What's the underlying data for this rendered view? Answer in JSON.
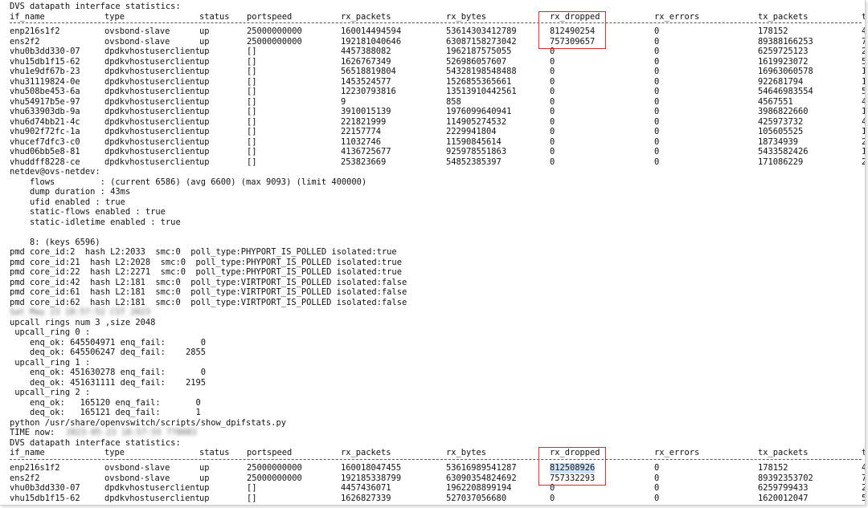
{
  "block1": {
    "title": "DVS datapath interface statistics:",
    "headers": [
      "if_name",
      "type",
      "status",
      "portspeed",
      "rx_packets",
      "rx_bytes",
      "rx_dropped",
      "rx_errors",
      "tx_packets",
      "t"
    ],
    "rows": [
      [
        "enp216s1f2",
        "ovsbond-slave",
        "up",
        "25000000000",
        "160014494594",
        "53614303412789",
        "812490254",
        "0",
        "178152",
        "4"
      ],
      [
        "ens2f2",
        "ovsbond-slave",
        "up",
        "25000000000",
        "192181040646",
        "63087158273042",
        "757309657",
        "0",
        "89388166253",
        "7"
      ],
      [
        "vhu0b3dd330-07",
        "dpdkvhostuserclient",
        "up",
        "[]",
        "4457388082",
        "1962187575055",
        "0",
        "0",
        "6259725123",
        "2"
      ],
      [
        "vhu15db1f15-62",
        "dpdkvhostuserclient",
        "up",
        "[]",
        "1626767349",
        "526986057607",
        "0",
        "0",
        "1619923072",
        "5"
      ],
      [
        "vhu1e9df67b-23",
        "dpdkvhostuserclient",
        "up",
        "[]",
        "56518819804",
        "54328198548488",
        "0",
        "0",
        "16963060578",
        "1"
      ],
      [
        "vhu31119824-0e",
        "dpdkvhostuserclient",
        "up",
        "[]",
        "1453524577",
        "1526855365661",
        "0",
        "0",
        "922681794",
        "1"
      ],
      [
        "vhu508be453-6a",
        "dpdkvhostuserclient",
        "up",
        "[]",
        "12230793816",
        "13513910442561",
        "0",
        "0",
        "54646983554",
        "5"
      ],
      [
        "vhu54917b5e-97",
        "dpdkvhostuserclient",
        "up",
        "[]",
        "9",
        "858",
        "0",
        "0",
        "4567551",
        "4"
      ],
      [
        "vhu633903db-9a",
        "dpdkvhostuserclient",
        "up",
        "[]",
        "3910015139",
        "1976099640941",
        "0",
        "0",
        "3986822660",
        "1"
      ],
      [
        "vhu6d74bb21-4c",
        "dpdkvhostuserclient",
        "up",
        "[]",
        "221821999",
        "114905274532",
        "0",
        "0",
        "425973732",
        "4"
      ],
      [
        "vhu902f72fc-1a",
        "dpdkvhostuserclient",
        "up",
        "[]",
        "22157774",
        "2229941804",
        "0",
        "0",
        "105605525",
        "1"
      ],
      [
        "vhucef7dfc3-c0",
        "dpdkvhostuserclient",
        "up",
        "[]",
        "11032746",
        "11590845614",
        "0",
        "0",
        "18734939",
        "2"
      ],
      [
        "vhud06bb5e8-81",
        "dpdkvhostuserclient",
        "up",
        "[]",
        "4136725677",
        "925978551863",
        "0",
        "0",
        "5433582426",
        "1"
      ],
      [
        "vhuddff8228-ce",
        "dpdkvhostuserclient",
        "up",
        "[]",
        "253823669",
        "54852385397",
        "0",
        "0",
        "171086229",
        "2"
      ]
    ]
  },
  "netdev_lines": [
    "netdev@ovs-netdev:",
    "    flows         : (current 6586) (avg 6600) (max 9093) (limit 400000)",
    "    dump duration : 43ms",
    "    ufid enabled : true",
    "    static-flows enabled : true",
    "    static-idletime enabled : true",
    "",
    "    8: (keys 6596)",
    "pmd core_id:2  hash L2:2033  smc:0  poll_type:PHYPORT_IS_POLLED isolated:true",
    "pmd core_id:21  hash L2:2028  smc:0  poll_type:PHYPORT_IS_POLLED isolated:true",
    "pmd core_id:22  hash L2:2271  smc:0  poll_type:PHYPORT_IS_POLLED isolated:true",
    "pmd core_id:42  hash L2:181  smc:0  poll_type:VIRTPORT_IS_POLLED isolated:false",
    "pmd core_id:61  hash L2:181  smc:0  poll_type:VIRTPORT_IS_POLLED isolated:false",
    "pmd core_id:62  hash L2:181  smc:0  poll_type:VIRTPORT_IS_POLLED isolated:false"
  ],
  "blurred_date": "Sat May 23 18:57:52 CST 2023",
  "upcall_lines": [
    "upcall rings num 3 ,size 2048",
    " upcall_ring 0 :",
    "    enq_ok: 645504971 enq_fail:       0",
    "    deq_ok: 645506247 deq_fail:    2855",
    " upcall_ring 1 :",
    "    enq_ok: 451630278 enq_fail:       0",
    "    deq_ok: 451631111 deq_fail:    2195",
    " upcall_ring 2 :",
    "    enq_ok:   165120 enq_fail:       0",
    "    deq_ok:   165121 deq_fail:       1",
    "python /usr/share/openvswitch/scripts/show_dpifstats.py"
  ],
  "time_now_label": "TIME now:",
  "time_now_blurred": "2023-05-23 18:57:55 778083",
  "block2": {
    "title": "DVS datapath interface statistics:",
    "headers": [
      "if_name",
      "type",
      "status",
      "portspeed",
      "rx_packets",
      "rx_bytes",
      "rx_dropped",
      "rx_errors",
      "tx_packets",
      "t"
    ],
    "rows": [
      [
        "enp216s1f2",
        "ovsbond-slave",
        "up",
        "25000000000",
        "160018047455",
        "53616989541287",
        "812508926",
        "0",
        "178152",
        "4"
      ],
      [
        "ens2f2",
        "ovsbond-slave",
        "up",
        "25000000000",
        "192185338799",
        "63090354824692",
        "757332293",
        "0",
        "89392353702",
        "7"
      ],
      [
        "vhu0b3dd330-07",
        "dpdkvhostuserclient",
        "up",
        "[]",
        "4457436071",
        "1962208899194",
        "0",
        "0",
        "6259799433",
        "2"
      ],
      [
        "vhu15db1f15-62",
        "dpdkvhostuserclient",
        "up",
        "[]",
        "1626827339",
        "527037056680",
        "0",
        "0",
        "1620012047",
        "5"
      ]
    ]
  },
  "colors": {
    "annotation": "#e02828",
    "selection": "#cfe3f7"
  }
}
